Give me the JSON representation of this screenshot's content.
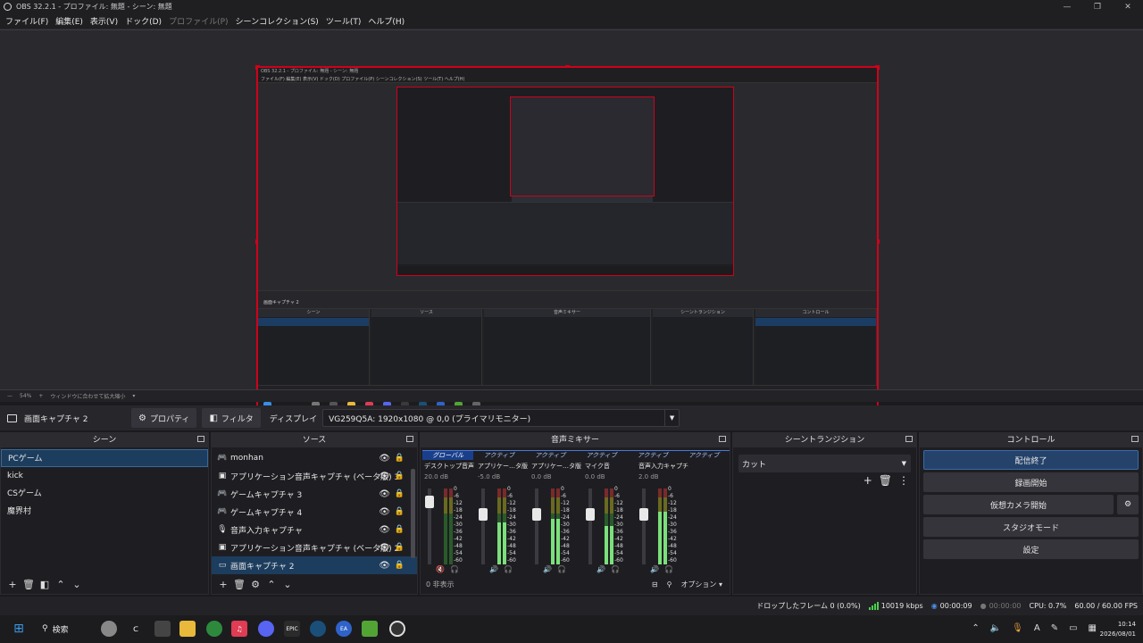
{
  "window": {
    "title": "OBS 32.2.1 - プロファイル: 無題 - シーン: 無題",
    "controls": [
      "—",
      "❐",
      "✕"
    ]
  },
  "menu": [
    {
      "label": "ファイル(F)",
      "enabled": true
    },
    {
      "label": "編集(E)",
      "enabled": true
    },
    {
      "label": "表示(V)",
      "enabled": true
    },
    {
      "label": "ドック(D)",
      "enabled": true
    },
    {
      "label": "プロファイル(P)",
      "enabled": false
    },
    {
      "label": "シーンコレクション(S)",
      "enabled": true
    },
    {
      "label": "ツール(T)",
      "enabled": true
    },
    {
      "label": "ヘルプ(H)",
      "enabled": true
    }
  ],
  "zoombar": {
    "zoom": "54%",
    "mode": "ウィンドウに合わせて拡大縮小"
  },
  "source_toolbar": {
    "source_name": "画面キャプチャ 2",
    "properties_label": "プロパティ",
    "filters_label": "フィルタ",
    "display_label": "ディスプレイ",
    "display_value": "VG259Q5A: 1920x1080 @ 0,0 (プライマリモニター)"
  },
  "scenes": {
    "title": "シーン",
    "items": [
      {
        "label": "PCゲーム",
        "selected": true
      },
      {
        "label": "kick",
        "selected": false
      },
      {
        "label": "CSゲーム",
        "selected": false
      },
      {
        "label": "魔界村",
        "selected": false
      }
    ]
  },
  "sources": {
    "title": "ソース",
    "items": [
      {
        "label": "monhan",
        "icon": "gamepad-icon",
        "selected": false
      },
      {
        "label": "アプリケーション音声キャプチャ (ベータ版) 3",
        "icon": "app-audio-icon",
        "selected": false
      },
      {
        "label": "ゲームキャプチャ 3",
        "icon": "gamepad-icon",
        "selected": false
      },
      {
        "label": "ゲームキャプチャ 4",
        "icon": "gamepad-icon",
        "selected": false
      },
      {
        "label": "音声入力キャプチャ",
        "icon": "mic-icon",
        "selected": false
      },
      {
        "label": "アプリケーション音声キャプチャ (ベータ版) 2",
        "icon": "app-audio-icon",
        "selected": false
      },
      {
        "label": "画面キャプチャ 2",
        "icon": "monitor-icon",
        "selected": true
      }
    ]
  },
  "mixer": {
    "title": "音声ミキサー",
    "tabs": [
      "グローバル",
      "アクティブ",
      "アクティブ",
      "アクティブ",
      "アクティブ",
      "アクティブ"
    ],
    "channels": [
      {
        "name": "デスクトップ音声",
        "db": "20.0 dB",
        "level": 0.0,
        "muted": true
      },
      {
        "name": "アプリケー…タ版) 2",
        "db": "-5.0 dB",
        "level": 0.55,
        "muted": false
      },
      {
        "name": "アプリケー…タ版) 3",
        "db": "0.0 dB",
        "level": 0.6,
        "muted": false
      },
      {
        "name": "マイク音",
        "db": "0.0 dB",
        "level": 0.5,
        "muted": false
      },
      {
        "name": "音声入力キャプチャ",
        "db": "2.0 dB",
        "level": 0.7,
        "muted": false
      }
    ],
    "scale": [
      "0",
      "-6",
      "-12",
      "-18",
      "-24",
      "-30",
      "-36",
      "-42",
      "-48",
      "-54",
      "-60"
    ],
    "hidden_label": "0 非表示",
    "options_label": "オプション"
  },
  "transitions": {
    "title": "シーントランジション",
    "value": "カット"
  },
  "controls": {
    "title": "コントロール",
    "stop_stream": "配信終了",
    "start_record": "録画開始",
    "start_virtualcam": "仮想カメラ開始",
    "studio_mode": "スタジオモード",
    "settings": "設定"
  },
  "status": {
    "dropped": "ドロップしたフレーム 0 (0.0%)",
    "bitrate": "10019 kbps",
    "stream_time": "00:00:09",
    "record_time": "00:00:00",
    "cpu": "CPU: 0.7%",
    "fps": "60.00 / 60.00 FPS"
  },
  "taskbar": {
    "search_label": "検索",
    "time": "10:14",
    "date": "2026/08/01"
  },
  "nested": {
    "menu": "ファイル(F)  編集(E)  表示(V)  ドック(D)  プロファイル(P)  シーンコレクション(S)  ツール(T)  ヘルプ(H)",
    "source_name": "画面キャプチャ 2"
  },
  "colors": {
    "accent": "#1c3d5e",
    "selection_border": "#d0001a",
    "meter_green": "#7be07b"
  }
}
